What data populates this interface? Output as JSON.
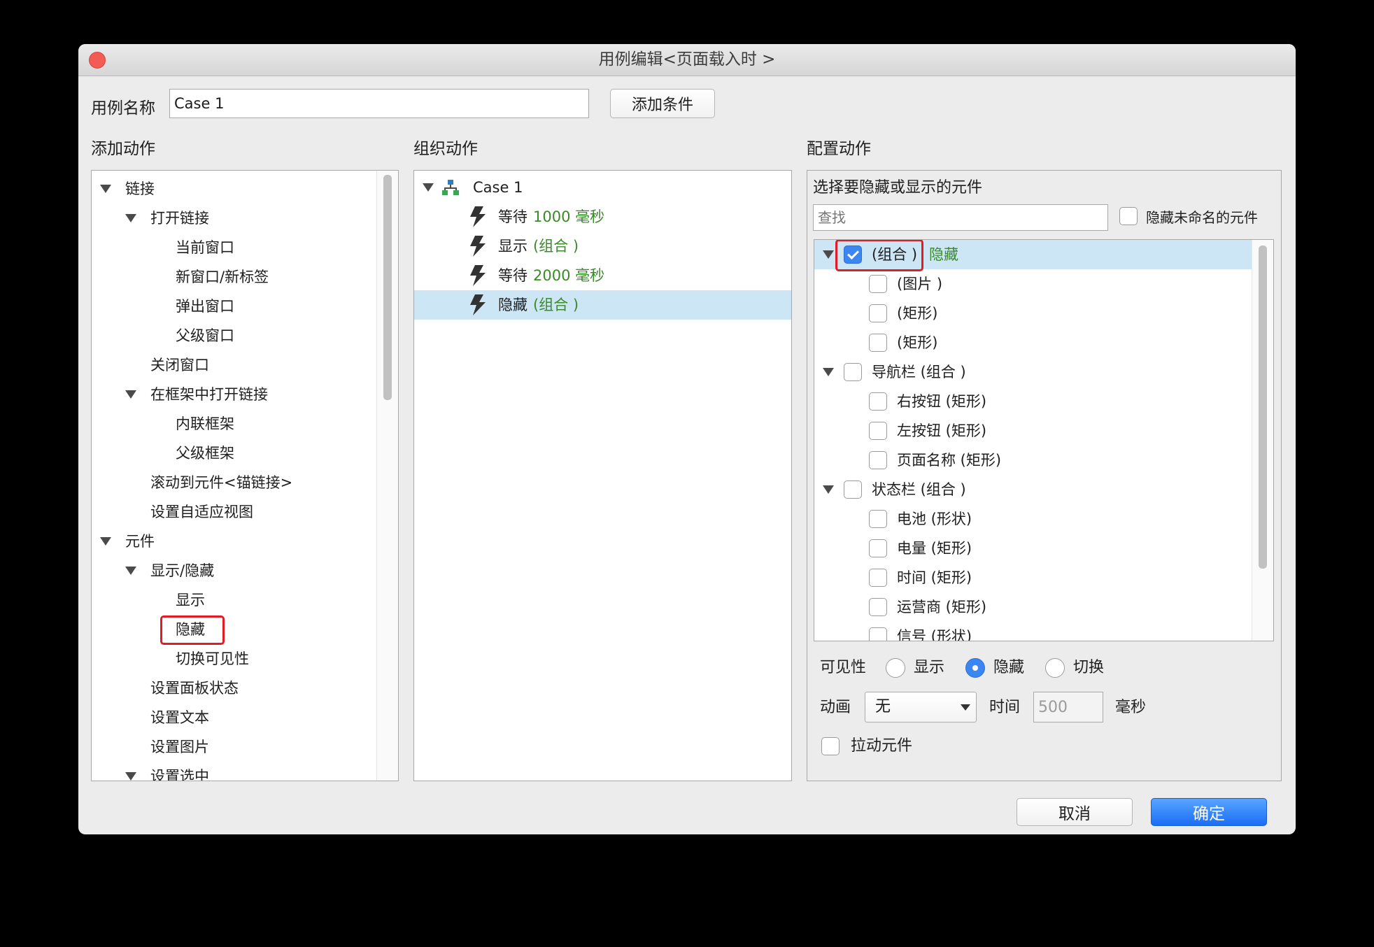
{
  "window": {
    "title": "用例编辑<页面载入时 >"
  },
  "case_name": {
    "label": "用例名称",
    "value": "Case 1",
    "add_condition": "添加条件"
  },
  "add_actions": {
    "title": "添加动作",
    "items": [
      {
        "label": "链接",
        "level": 0,
        "expanded": true
      },
      {
        "label": "打开链接",
        "level": 1,
        "expanded": true
      },
      {
        "label": "当前窗口",
        "level": 2
      },
      {
        "label": "新窗口/新标签",
        "level": 2
      },
      {
        "label": "弹出窗口",
        "level": 2
      },
      {
        "label": "父级窗口",
        "level": 2
      },
      {
        "label": "关闭窗口",
        "level": 1
      },
      {
        "label": "在框架中打开链接",
        "level": 1,
        "expanded": true
      },
      {
        "label": "内联框架",
        "level": 2
      },
      {
        "label": "父级框架",
        "level": 2
      },
      {
        "label": "滚动到元件<锚链接>",
        "level": 1
      },
      {
        "label": "设置自适应视图",
        "level": 1
      },
      {
        "label": "元件",
        "level": 0,
        "expanded": true
      },
      {
        "label": "显示/隐藏",
        "level": 1,
        "expanded": true
      },
      {
        "label": "显示",
        "level": 2
      },
      {
        "label": "隐藏",
        "level": 2,
        "highlighted": true
      },
      {
        "label": "切换可见性",
        "level": 2
      },
      {
        "label": "设置面板状态",
        "level": 1
      },
      {
        "label": "设置文本",
        "level": 1
      },
      {
        "label": "设置图片",
        "level": 1
      },
      {
        "label": "设置选中",
        "level": 1,
        "expanded": true
      }
    ]
  },
  "organize_actions": {
    "title": "组织动作",
    "case_label": "Case 1",
    "actions": [
      {
        "verb": "等待",
        "detail": "1000 毫秒"
      },
      {
        "verb": "显示",
        "detail": "(组合 )"
      },
      {
        "verb": "等待",
        "detail": "2000 毫秒"
      },
      {
        "verb": "隐藏",
        "detail": "(组合 )",
        "selected": true
      }
    ]
  },
  "configure_actions": {
    "title": "配置动作",
    "subtitle": "选择要隐藏或显示的元件",
    "search_placeholder": "查找",
    "hide_unnamed": "隐藏未命名的元件",
    "widgets": [
      {
        "label": "(组合 )",
        "status": "隐藏",
        "level": 0,
        "expanded": true,
        "checked": true,
        "selected": true
      },
      {
        "label": "(图片 )",
        "level": 1
      },
      {
        "label": "(矩形)",
        "level": 1
      },
      {
        "label": "(矩形)",
        "level": 1
      },
      {
        "label": "导航栏 (组合 )",
        "level": 0,
        "expanded": true
      },
      {
        "label": "右按钮 (矩形)",
        "level": 1
      },
      {
        "label": "左按钮 (矩形)",
        "level": 1
      },
      {
        "label": "页面名称 (矩形)",
        "level": 1
      },
      {
        "label": "状态栏 (组合 )",
        "level": 0,
        "expanded": true
      },
      {
        "label": "电池 (形状)",
        "level": 1
      },
      {
        "label": "电量 (矩形)",
        "level": 1
      },
      {
        "label": "时间 (矩形)",
        "level": 1
      },
      {
        "label": "运营商 (矩形)",
        "level": 1
      },
      {
        "label": "信号 (形状)",
        "level": 1
      }
    ],
    "visibility": {
      "label": "可见性",
      "options": [
        {
          "label": "显示",
          "selected": false
        },
        {
          "label": "隐藏",
          "selected": true
        },
        {
          "label": "切换",
          "selected": false
        }
      ]
    },
    "animation": {
      "label": "动画",
      "value": "无"
    },
    "time": {
      "label": "时间",
      "value": "500",
      "unit": "毫秒"
    },
    "drag_widget": "拉动元件"
  },
  "footer": {
    "cancel": "取消",
    "ok": "确定"
  },
  "colors": {
    "accent": "#3c86f2",
    "selection": "#cde6f5",
    "green_text": "#3a8a2a",
    "highlight_box": "#e21c24",
    "close": "#f25c54"
  }
}
